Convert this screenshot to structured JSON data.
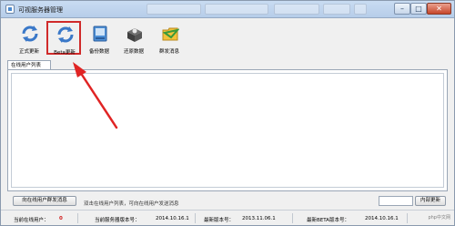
{
  "window": {
    "title": "可视服务器管理"
  },
  "toolbar": {
    "items": [
      {
        "label": "正式更新",
        "icon": "refresh-blue-icon"
      },
      {
        "label": "Beta更新",
        "icon": "refresh-blue-icon"
      },
      {
        "label": "备份数据",
        "icon": "backup-drive-icon"
      },
      {
        "label": "还原数据",
        "icon": "restore-box-icon"
      },
      {
        "label": "群发消息",
        "icon": "message-folder-icon"
      }
    ]
  },
  "tabs": {
    "online_users": "在线用户列表"
  },
  "bottom": {
    "broadcast_button": "向在线用户群发消息",
    "hint": "双击在线用户列表，可向在线用户发送消息",
    "internal_update_button": "内部更新"
  },
  "status": {
    "online_label": "当前在线用户：",
    "online_count": "0",
    "server_version_label": "当前服务器版本号：",
    "server_version": "2014.10.16.1",
    "latest_version_label": "最新版本号：",
    "latest_version": "2013.11.06.1",
    "latest_beta_label": "最新BETA版本号：",
    "latest_beta": "2014.10.16.1"
  },
  "watermark": "php中文网",
  "colors": {
    "highlight": "#d02a2a",
    "accent_blue": "#3a78c8"
  }
}
